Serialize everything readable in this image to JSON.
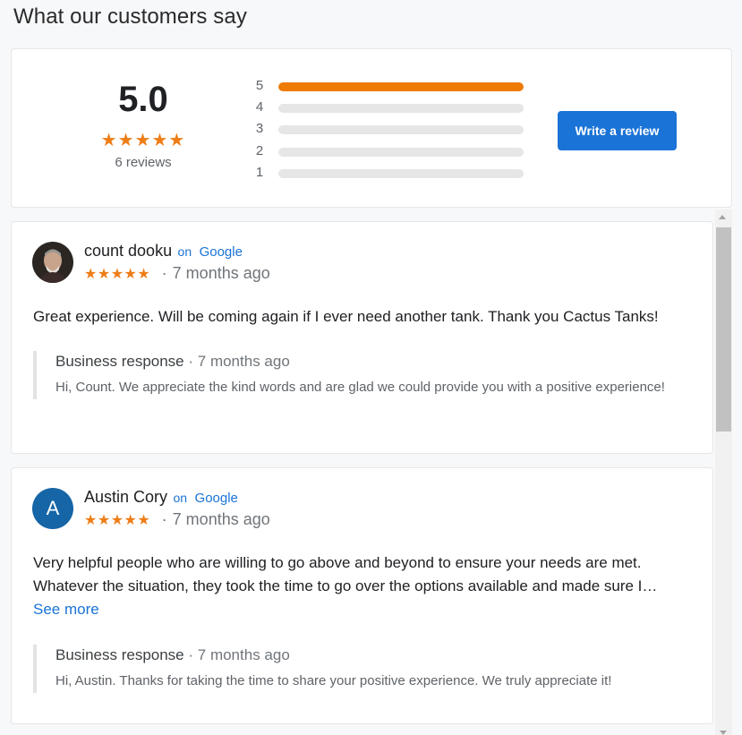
{
  "page": {
    "title": "What our customers say"
  },
  "summary": {
    "average": "5.0",
    "stars": "★★★★★",
    "count_label": "6 reviews",
    "distribution": [
      {
        "label": "5",
        "fraction": 1.0
      },
      {
        "label": "4",
        "fraction": 0.0
      },
      {
        "label": "3",
        "fraction": 0.0
      },
      {
        "label": "2",
        "fraction": 0.0
      },
      {
        "label": "1",
        "fraction": 0.0
      }
    ],
    "write_review_label": "Write a review"
  },
  "colors": {
    "accent": "#1a73d6",
    "star": "#ee7d16",
    "bar_fill": "#ef7b07"
  },
  "reviews": [
    {
      "author": "count dooku",
      "on_label": "on",
      "source": "Google",
      "stars": "★★★★★",
      "time": "7 months ago",
      "text": "Great experience. Will be coming again if I ever need another tank. Thank you Cactus Tanks!",
      "response": {
        "label": "Business response",
        "time": "7 months ago",
        "text": "Hi, Count. We appreciate the kind words and are glad we could provide you with a positive experience!"
      }
    },
    {
      "author": "Austin Cory",
      "avatar_letter": "A",
      "on_label": "on",
      "source": "Google",
      "stars": "★★★★★",
      "time": "7 months ago",
      "text": "Very helpful people who are willing to go above and beyond to ensure your needs are met. Whatever the situation, they took the time to go over the options available and made sure I…",
      "see_more": "See more",
      "response": {
        "label": "Business response",
        "time": "7 months ago",
        "text": "Hi, Austin. Thanks for taking the time to share your positive experience. We truly appreciate it!"
      }
    }
  ]
}
